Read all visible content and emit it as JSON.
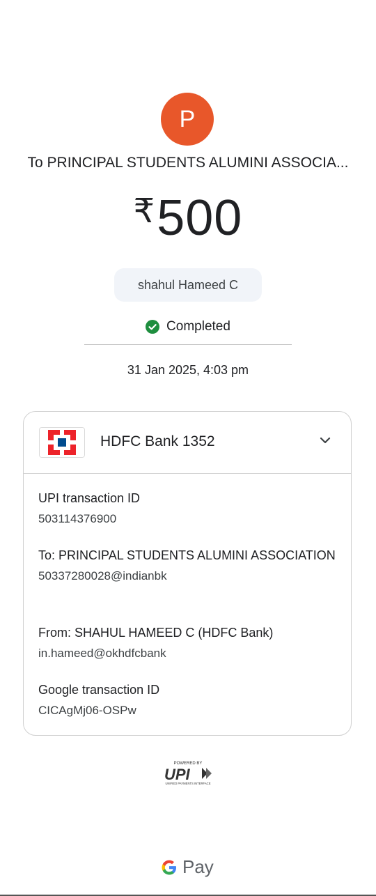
{
  "avatar": {
    "initial": "P",
    "color": "#e8572a"
  },
  "recipient_line": "To PRINCIPAL STUDENTS ALUMINI ASSOCIA...",
  "amount": {
    "currency": "₹",
    "value": "500"
  },
  "note": "shahul Hameed C",
  "status": {
    "label": "Completed",
    "icon": "check-circle-icon",
    "color": "#1e8e3e"
  },
  "datetime": "31 Jan 2025, 4:03 pm",
  "account": {
    "bank_name": "HDFC Bank 1352",
    "logo": "hdfc-bank-logo",
    "expand_icon": "chevron-down-icon"
  },
  "details": [
    {
      "label": "UPI transaction ID",
      "value": "503114376900"
    },
    {
      "label": "To: PRINCIPAL STUDENTS ALUMINI ASSOCIATION",
      "value": "50337280028@indianbk"
    },
    {
      "label": "From: SHAHUL HAMEED C (HDFC Bank)",
      "value": "in.hameed@okhdfcbank"
    },
    {
      "label": "Google transaction ID",
      "value": "CICAgMj06-OSPw"
    }
  ],
  "upi_logo": {
    "powered_by": "POWERED BY",
    "brand": "UPI",
    "subtitle": "UNIFIED PAYMENTS INTERFACE"
  },
  "footer": {
    "brand": "Pay",
    "icon": "google-g-icon"
  }
}
